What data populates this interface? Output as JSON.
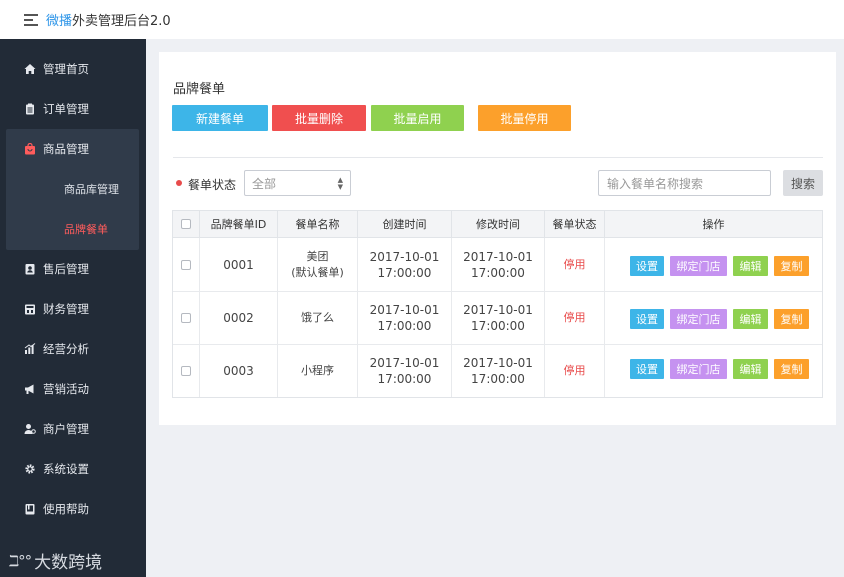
{
  "header": {
    "title_highlight": "微播",
    "title_rest": "外卖管理后台2.0"
  },
  "sidebar": {
    "items": [
      {
        "label": "管理首页",
        "icon": "home-icon"
      },
      {
        "label": "订单管理",
        "icon": "clipboard-icon"
      },
      {
        "label": "商品管理",
        "icon": "bag-icon"
      },
      {
        "label": "售后管理",
        "icon": "id-card-icon"
      },
      {
        "label": "财务管理",
        "icon": "calculator-icon"
      },
      {
        "label": "经营分析",
        "icon": "bar-chart-icon"
      },
      {
        "label": "营销活动",
        "icon": "megaphone-icon"
      },
      {
        "label": "商户管理",
        "icon": "user-icon"
      },
      {
        "label": "系统设置",
        "icon": "gear-icon"
      },
      {
        "label": "使用帮助",
        "icon": "book-icon"
      }
    ],
    "sub_items": [
      {
        "label": "商品库管理"
      },
      {
        "label": "品牌餐单"
      }
    ],
    "logo_mark": "ℶ°°",
    "logo_text": "大数跨境"
  },
  "main": {
    "title": "品牌餐单",
    "buttons": {
      "new": "新建餐单",
      "batch_delete": "批量删除",
      "batch_enable": "批量启用",
      "batch_disable": "批量停用"
    },
    "filter": {
      "label": "餐单状态",
      "select_value": "全部",
      "search_placeholder": "输入餐单名称搜索",
      "search_button": "搜索"
    },
    "table": {
      "columns": [
        "品牌餐单ID",
        "餐单名称",
        "创建时间",
        "修改时间",
        "餐单状态",
        "操作"
      ],
      "rows": [
        {
          "id": "0001",
          "name_line1": "美团",
          "name_line2": "(默认餐单)",
          "created_date": "2017-10-01",
          "created_time": "17:00:00",
          "modified_date": "2017-10-01",
          "modified_time": "17:00:00",
          "status": "停用"
        },
        {
          "id": "0002",
          "name_line1": "饿了么",
          "name_line2": "",
          "created_date": "2017-10-01",
          "created_time": "17:00:00",
          "modified_date": "2017-10-01",
          "modified_time": "17:00:00",
          "status": "停用"
        },
        {
          "id": "0003",
          "name_line1": "小程序",
          "name_line2": "",
          "created_date": "2017-10-01",
          "created_time": "17:00:00",
          "modified_date": "2017-10-01",
          "modified_time": "17:00:00",
          "status": "停用"
        }
      ],
      "actions": {
        "settings": "设置",
        "bind_store": "绑定门店",
        "edit": "编辑",
        "copy": "复制"
      }
    }
  },
  "colors": {
    "blue": "#3db5e8",
    "red": "#f04f4f",
    "green": "#8fd14f",
    "orange": "#fca02b",
    "purple": "#c592f0",
    "sidebar_bg": "#222b37"
  }
}
